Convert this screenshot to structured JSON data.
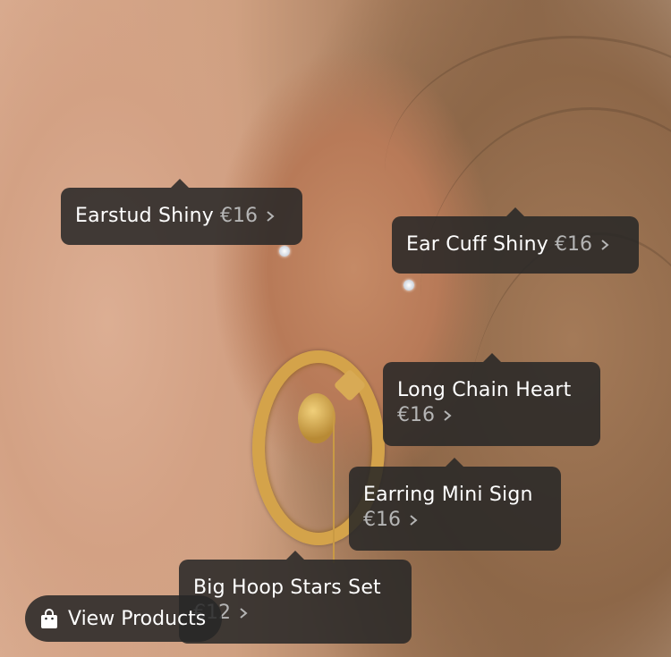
{
  "tags": [
    {
      "name": "Earstud Shiny",
      "price": "€16"
    },
    {
      "name": "Ear Cuff Shiny",
      "price": "€16"
    },
    {
      "name": "Long Chain Heart",
      "price": "€16"
    },
    {
      "name": "Earring Mini Sign",
      "price": "€16"
    },
    {
      "name": "Big Hoop Stars Set",
      "price": "€12"
    }
  ],
  "view_products": {
    "label": "View Products",
    "icon": "shopping-bag-icon"
  },
  "colors": {
    "tag_bg": "#262626",
    "tag_text": "#ffffff",
    "price_text": "#b5b5b5"
  }
}
